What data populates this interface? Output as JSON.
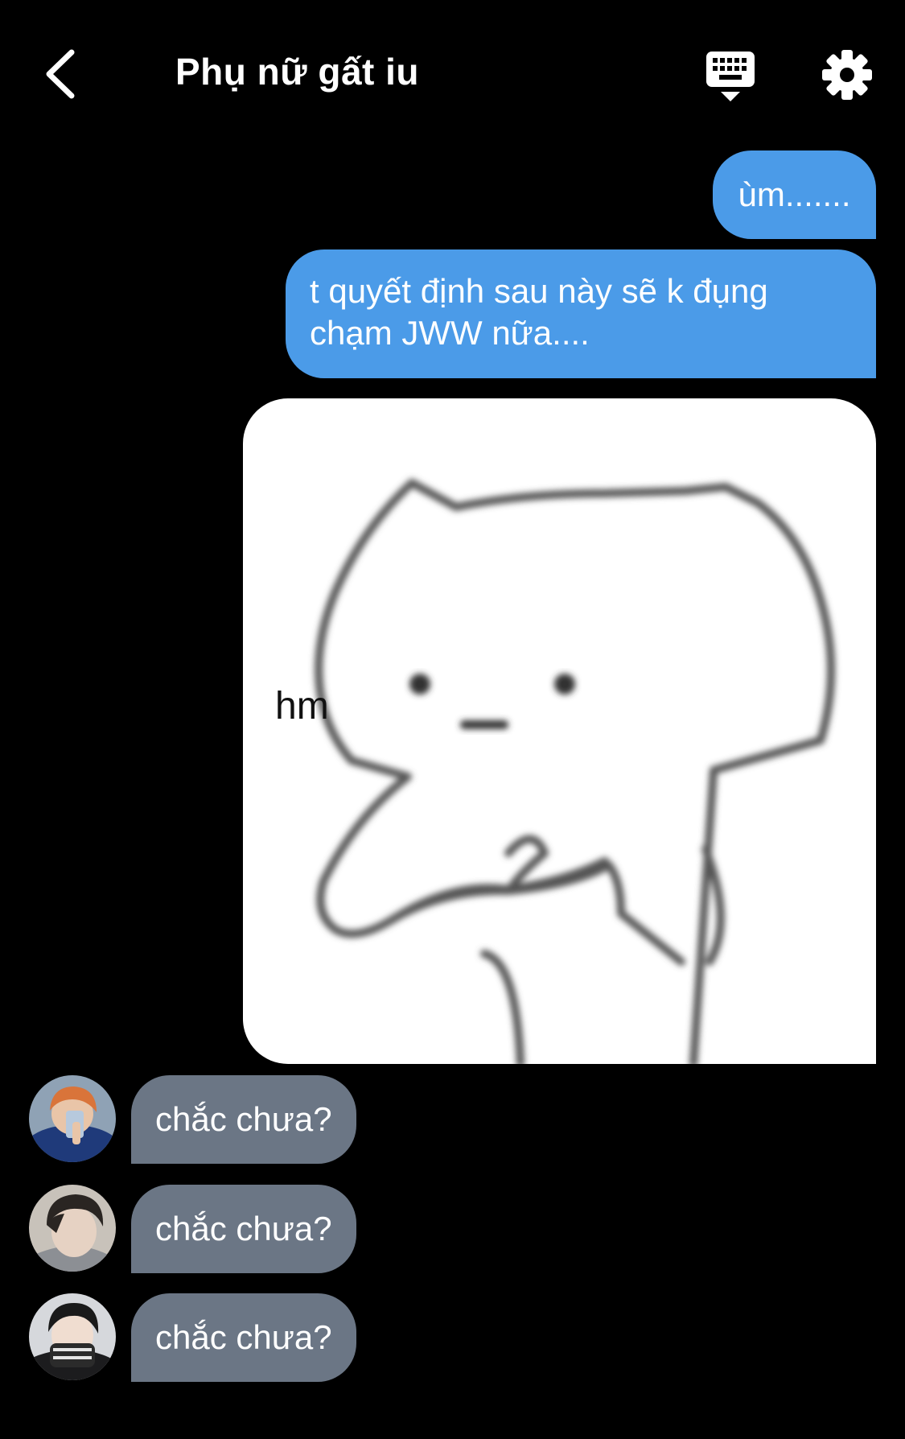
{
  "header": {
    "title": "Phụ nữ gất iu",
    "back_icon": "chevron-left-icon",
    "keyboard_icon": "keyboard-hide-icon",
    "settings_icon": "gear-icon"
  },
  "messages": {
    "sent": [
      {
        "text": "ùm......."
      },
      {
        "text": "t quyết định sau này sẽ k đụng chạm JWW nữa...."
      }
    ],
    "sticker": {
      "caption": "hm"
    },
    "received": [
      {
        "text": "chắc chưa?"
      },
      {
        "text": "chắc chưa?"
      },
      {
        "text": "chắc chưa?"
      }
    ]
  },
  "colors": {
    "background": "#000000",
    "sent_bubble": "#4b9be8",
    "received_bubble": "#6b7685",
    "text": "#ffffff"
  }
}
